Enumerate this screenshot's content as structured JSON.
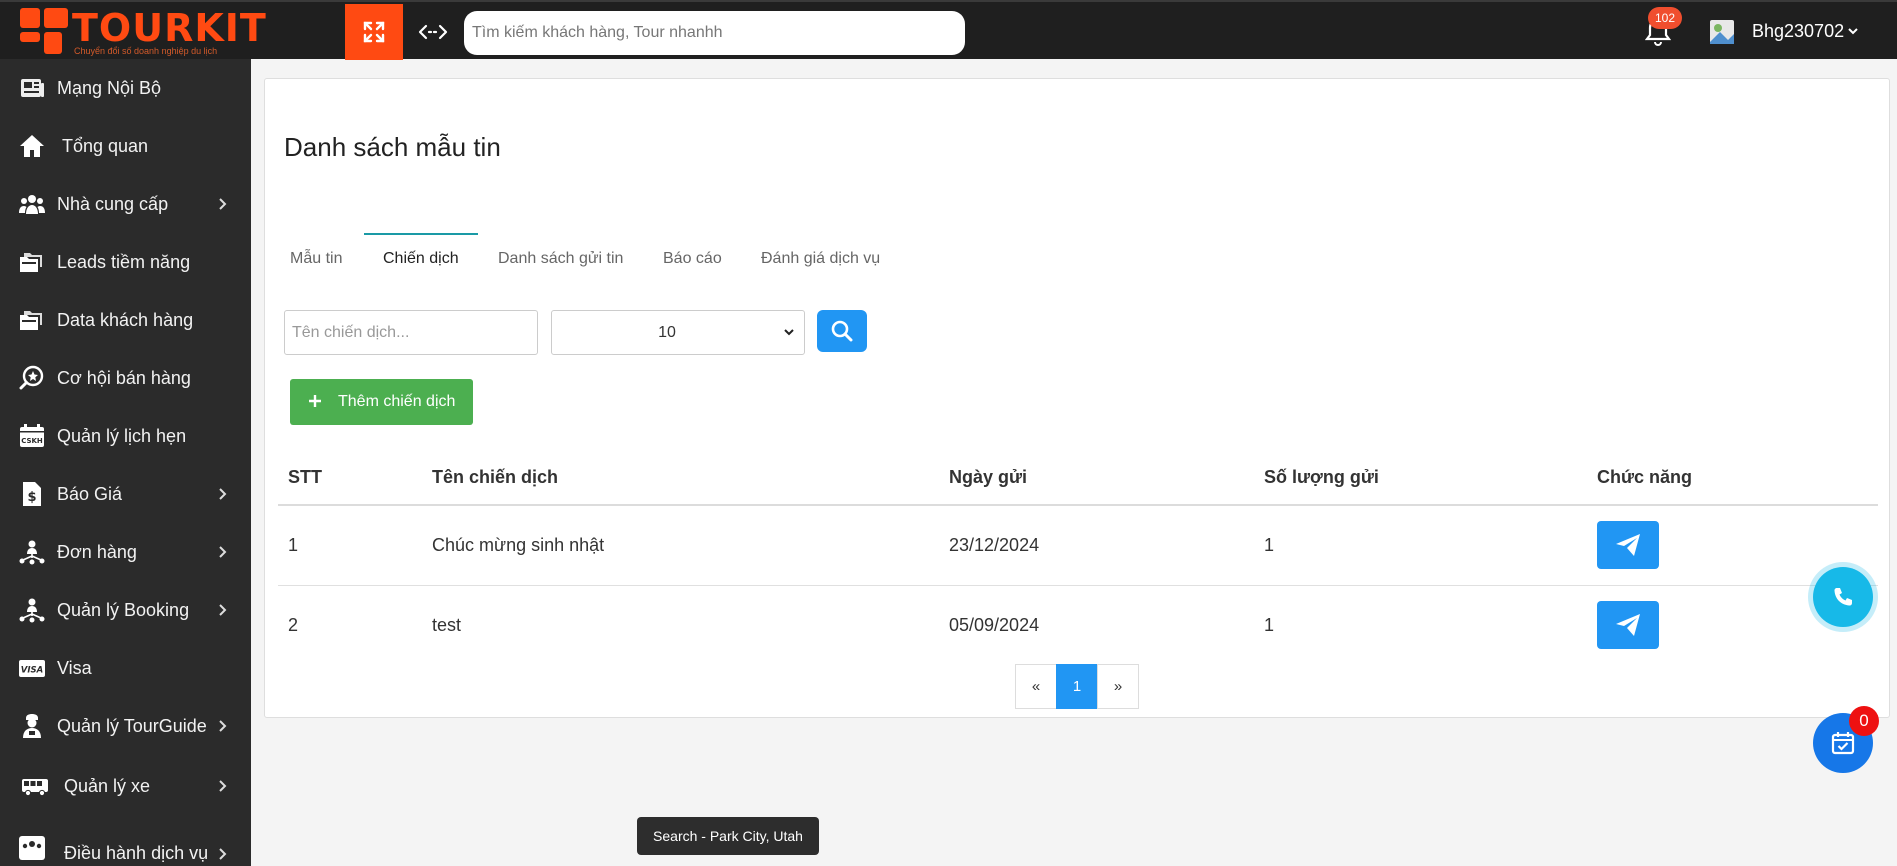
{
  "topbar": {
    "logo_text": "TOURKIT",
    "logo_slogan": "Chuyển đổi số doanh nghiệp du lịch",
    "search_placeholder": "Tìm kiếm khách hàng, Tour nhanhh",
    "notification_count": "102",
    "user_name": "Bhg230702",
    "brand_color": "#ff4a12"
  },
  "sidebar": {
    "items": [
      {
        "label": "Mạng Nội Bộ",
        "icon": "newspaper-icon",
        "chevron": false
      },
      {
        "label": "Tổng quan",
        "icon": "home-icon",
        "chevron": false
      },
      {
        "label": "Nhà cung cấp",
        "icon": "users-icon",
        "chevron": true
      },
      {
        "label": "Leads tiềm năng",
        "icon": "folders-icon",
        "chevron": false
      },
      {
        "label": "Data khách hàng",
        "icon": "folders-icon",
        "chevron": false
      },
      {
        "label": "Cơ hội bán hàng",
        "icon": "search-star-icon",
        "chevron": false
      },
      {
        "label": "Quản lý lịch hẹn",
        "icon": "cskh-calendar-icon",
        "chevron": false
      },
      {
        "label": "Báo Giá",
        "icon": "dollar-file-icon",
        "chevron": true
      },
      {
        "label": "Đơn hàng",
        "icon": "network-icon",
        "chevron": true
      },
      {
        "label": "Quản lý Booking",
        "icon": "network-icon",
        "chevron": true
      },
      {
        "label": "Visa",
        "icon": "visa-card-icon",
        "chevron": false
      },
      {
        "label": "Quản lý TourGuide",
        "icon": "guide-person-icon",
        "chevron": true
      },
      {
        "label": "Quản lý xe",
        "icon": "bus-icon",
        "chevron": true
      },
      {
        "label": "Điều hành dịch vụ",
        "icon": "team-icon",
        "chevron": true
      }
    ]
  },
  "main": {
    "title": "Danh sách mẫu tin",
    "tabs": [
      {
        "label": "Mẫu tin"
      },
      {
        "label": "Chiến dịch"
      },
      {
        "label": "Danh sách gửi tin"
      },
      {
        "label": "Báo cáo"
      },
      {
        "label": "Đánh giá dịch vụ"
      }
    ],
    "active_tab": "Chiến dịch",
    "filter": {
      "name_placeholder": "Tên chiến dịch...",
      "page_size": "10"
    },
    "add_button_label": "Thêm chiến dịch",
    "table": {
      "headers": [
        "STT",
        "Tên chiến dịch",
        "Ngày gửi",
        "Số lượng gửi",
        "Chức năng"
      ],
      "rows": [
        [
          "1",
          "Chúc mừng sinh nhật",
          "23/12/2024",
          "1"
        ],
        [
          "2",
          "test",
          "05/09/2024",
          "1"
        ]
      ]
    },
    "pagination": {
      "prev": "«",
      "current": "1",
      "next": "»"
    }
  },
  "floating": {
    "task_count": "0",
    "tooltip": "Search - Park City, Utah"
  }
}
